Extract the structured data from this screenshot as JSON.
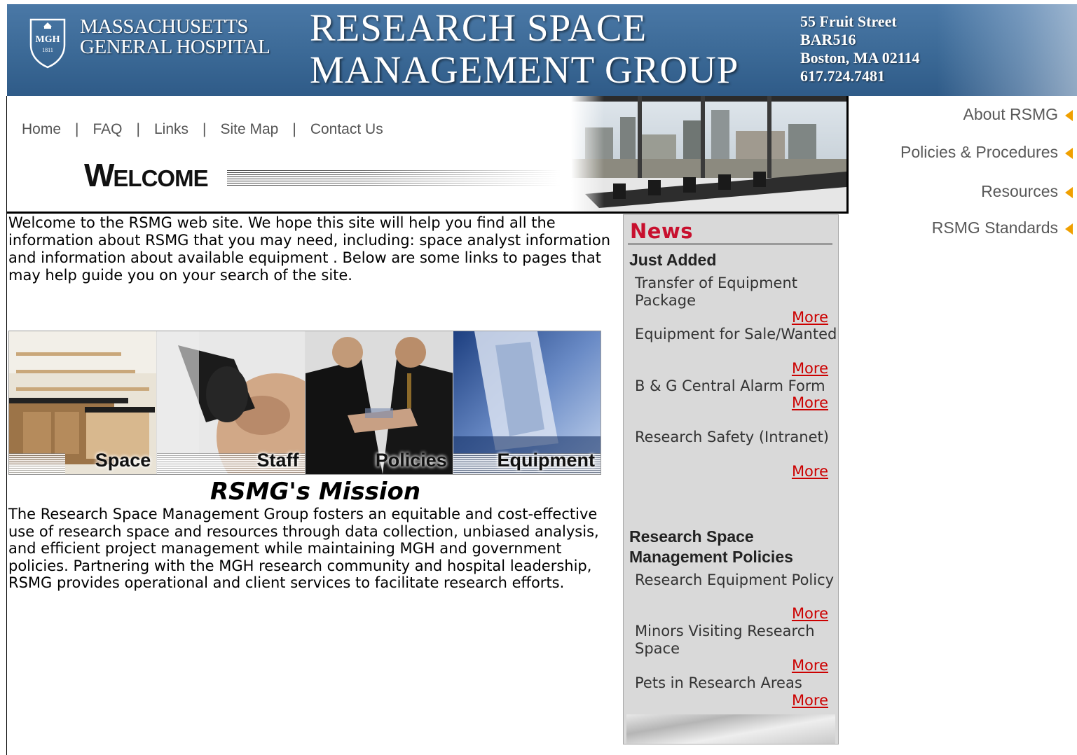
{
  "banner": {
    "hospital_line1": "MASSACHUSETTS",
    "hospital_line2": "GENERAL HOSPITAL",
    "shield_text": "MGH",
    "shield_year": "1811",
    "title_line1": "RESEARCH SPACE",
    "title_line2": "MANAGEMENT GROUP",
    "address_line1": "55 Fruit Street",
    "address_line2": "BAR516",
    "address_line3": "Boston, MA 02114",
    "address_line4": "617.724.7481"
  },
  "topnav": {
    "home": "Home",
    "faq": "FAQ",
    "links": "Links",
    "site_map": "Site Map",
    "contact_us": "Contact Us",
    "separator": "|"
  },
  "welcome": {
    "first_letter": "W",
    "rest": "ELCOME"
  },
  "side_menu": {
    "about": "About RSMG",
    "policies": "Policies & Procedures",
    "resources": "Resources",
    "standards": "RSMG Standards"
  },
  "intro": {
    "text": "Welcome to the RSMG web site. We hope this site will help you find all the information about RSMG that you may need, including: space analyst information and information about available equipment . Below are some links to pages that may help guide you on your search of the site."
  },
  "tiles": {
    "space": "Space",
    "staff": "Staff",
    "policies": "Policies",
    "equipment": "Equipment"
  },
  "mission": {
    "title": "RSMG's Mission",
    "body": "The Research Space Management Group fosters an equitable and cost-effective use of research space and resources through data collection, unbiased analysis, and efficient project management while maintaining MGH and government policies. Partnering with the MGH research community and hospital leadership, RSMG provides operational and client services to facilitate research efforts."
  },
  "news": {
    "title": "News",
    "section1": "Just Added",
    "item1": "Transfer of Equipment Package",
    "item2": "Equipment for Sale/Wanted",
    "item3": "B & G Central Alarm Form",
    "item4": "Research Safety (Intranet)",
    "section2_line1": "Research Space",
    "section2_line2": "Management Policies",
    "item5": "Research Equipment Policy",
    "item6": "Minors Visiting Research Space",
    "item7": "Pets in Research Areas",
    "more": "More"
  },
  "colors": {
    "banner_blue": "#3b6996",
    "news_red": "#c8102e",
    "more_link": "#cc0000",
    "menu_arrow": "#f0a000",
    "news_panel": "#d9d9d9"
  },
  "icons": {
    "menu_arrow": "left-triangle-icon",
    "logo": "mgh-shield-icon"
  }
}
